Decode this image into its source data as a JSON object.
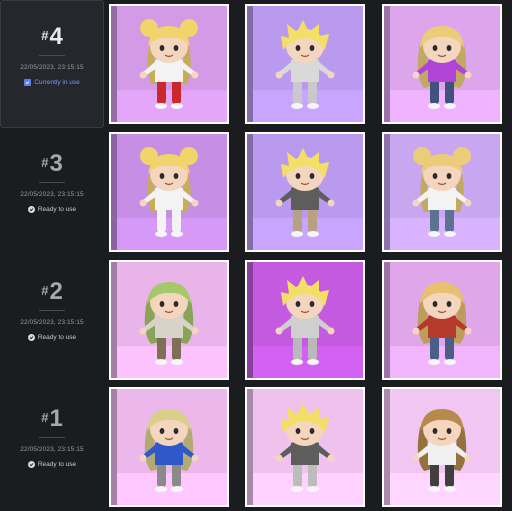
{
  "versions": [
    {
      "hash": "#",
      "number": "4",
      "date": "22/05/2023, 23:15:15",
      "status": "Currently in use",
      "status_icon": "checkbox-icon",
      "active": true,
      "accent": "#5e7df2",
      "thumbs": [
        {
          "bg": "#d39ae6",
          "hair": "#f1d46a",
          "shirt": "#f3f3f3",
          "pants": "#c9282d",
          "style": "buns"
        },
        {
          "bg": "#b99aef",
          "hair": "#f2df63",
          "shirt": "#d9d9d9",
          "pants": "#c9c9c9",
          "style": "spiky"
        },
        {
          "bg": "#dda6ec",
          "hair": "#ebcd79",
          "shirt": "#b043d8",
          "pants": "#41527c",
          "style": "long"
        }
      ]
    },
    {
      "hash": "#",
      "number": "3",
      "date": "22/05/2023, 23:15:15",
      "status": "Ready to use",
      "status_icon": "check-circle-icon",
      "active": false,
      "thumbs": [
        {
          "bg": "#c78ee6",
          "hair": "#f1d46a",
          "shirt": "#f3f3f3",
          "pants": "#f3f3f3",
          "style": "buns"
        },
        {
          "bg": "#b99aef",
          "hair": "#f2df63",
          "shirt": "#5d5d5d",
          "pants": "#b8a183",
          "style": "spiky"
        },
        {
          "bg": "#c9a6f0",
          "hair": "#ebcd79",
          "shirt": "#f3f3f3",
          "pants": "#5b7390",
          "style": "buns"
        }
      ]
    },
    {
      "hash": "#",
      "number": "2",
      "date": "22/05/2023, 23:15:15",
      "status": "Ready to use",
      "status_icon": "check-circle-icon",
      "active": false,
      "thumbs": [
        {
          "bg": "#e9b4ea",
          "hair": "#a7c86a",
          "shirt": "#d8d2c9",
          "pants": "#7e6f55",
          "style": "long"
        },
        {
          "bg": "#c35ae0",
          "hair": "#f2df63",
          "shirt": "#cfcfcf",
          "pants": "#b9b9b9",
          "style": "spiky"
        },
        {
          "bg": "#dfa7ea",
          "hair": "#e8c070",
          "shirt": "#b53a2c",
          "pants": "#4a5f86",
          "style": "long"
        }
      ]
    },
    {
      "hash": "#",
      "number": "1",
      "date": "22/05/2023, 23:15:15",
      "status": "Ready to use",
      "status_icon": "check-circle-icon",
      "active": false,
      "thumbs": [
        {
          "bg": "#ecb8ec",
          "hair": "#d9cf8a",
          "shirt": "#2f58c9",
          "pants": "#8a8a8a",
          "style": "long"
        },
        {
          "bg": "#efc2ee",
          "hair": "#f2df63",
          "shirt": "#5d5d5d",
          "pants": "#bcbcbc",
          "style": "spiky"
        },
        {
          "bg": "#f1c6f3",
          "hair": "#b58a4a",
          "shirt": "#f0f0f0",
          "pants": "#3f3f3f",
          "style": "long"
        }
      ]
    }
  ]
}
